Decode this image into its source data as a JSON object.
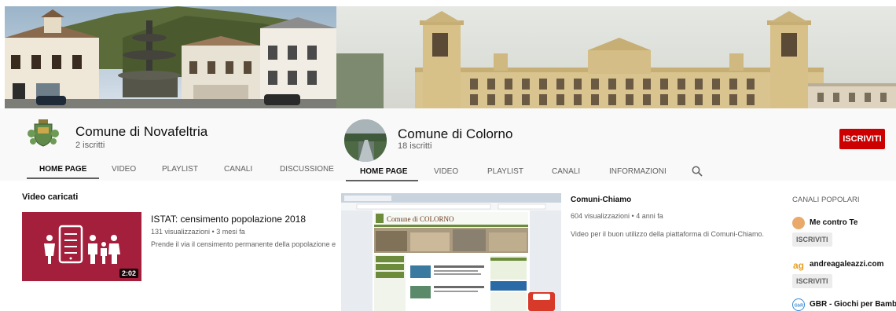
{
  "left": {
    "channel_name": "Comune di Novafeltria",
    "subscribers": "2 iscritti",
    "tabs": [
      {
        "label": "HOME PAGE",
        "active": true
      },
      {
        "label": "VIDEO",
        "active": false
      },
      {
        "label": "PLAYLIST",
        "active": false
      },
      {
        "label": "CANALI",
        "active": false
      },
      {
        "label": "DISCUSSIONE",
        "active": false
      }
    ],
    "section_title": "Video caricati",
    "video": {
      "title": "ISTAT: censimento popolazione 2018",
      "meta": "131 visualizzazioni • 3 mesi fa",
      "description": "Prende il via il censimento permanente della popolazione e delle a",
      "duration": "2:02"
    },
    "colors": {
      "thumb_bg": "#a31f3c"
    }
  },
  "right": {
    "channel_name": "Comune di Colorno",
    "subscribers": "18 iscritti",
    "subscribe_label": "ISCRIVITI",
    "tabs": [
      {
        "label": "HOME PAGE",
        "active": true
      },
      {
        "label": "VIDEO",
        "active": false
      },
      {
        "label": "PLAYLIST",
        "active": false
      },
      {
        "label": "CANALI",
        "active": false
      },
      {
        "label": "INFORMAZIONI",
        "active": false
      }
    ],
    "search_icon": "search-icon",
    "video": {
      "title": "Comuni-Chiamo",
      "meta": "604 visualizzazioni • 4 anni fa",
      "description": "Video per il buon utilizzo della piattaforma di Comuni-Chiamo.",
      "thumb_site_title": "Comune di COLORNO"
    },
    "popular": {
      "heading": "CANALI POPOLARI",
      "channels": [
        {
          "name": "Me contro Te",
          "button": "ISCRIVITI"
        },
        {
          "name": "andreagaleazzi.com",
          "button": "ISCRIVITI"
        },
        {
          "name": "GBR - Giochi per Bamb…",
          "button": ""
        }
      ]
    },
    "colors": {
      "subscribe": "#cc0000"
    }
  }
}
